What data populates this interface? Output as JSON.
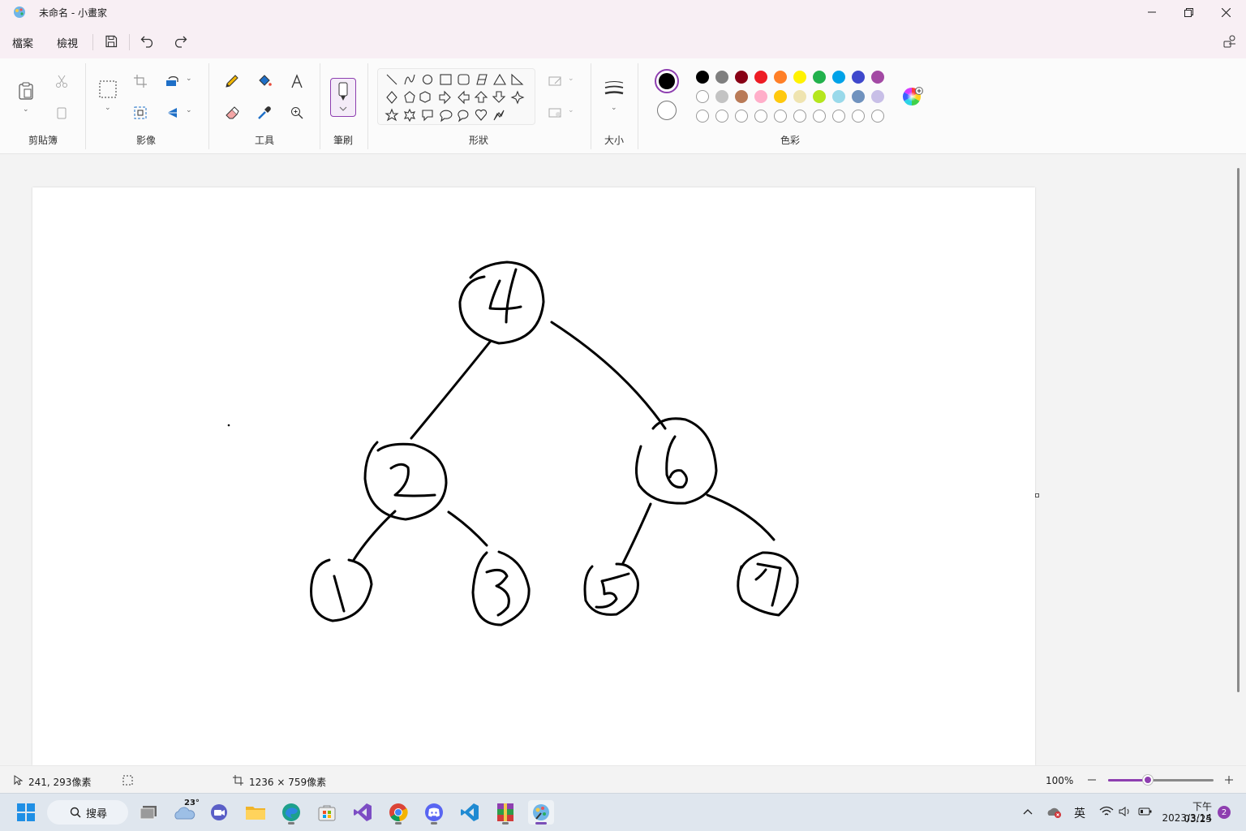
{
  "window": {
    "title": "未命名 - 小畫家"
  },
  "menu": {
    "file": "檔案",
    "view": "檢視"
  },
  "ribbon": {
    "groups": {
      "clipboard": "剪貼簿",
      "image": "影像",
      "tools": "工具",
      "brush": "筆刷",
      "shapes": "形狀",
      "size": "大小",
      "colors": "色彩"
    },
    "colors": {
      "primary": "#000000",
      "secondary": "#ffffff",
      "row1": [
        "#000000",
        "#7f7f7f",
        "#880015",
        "#ed1c24",
        "#ff7f27",
        "#fff200",
        "#22b14c",
        "#00a2e8",
        "#3f48cc",
        "#a349a4"
      ],
      "row2": [
        "#ffffff",
        "#c3c3c3",
        "#b97a57",
        "#ffaec9",
        "#ffc90e",
        "#efe4b0",
        "#b5e61d",
        "#99d9ea",
        "#7092be",
        "#c8bfe7"
      ]
    }
  },
  "drawing": {
    "nodes": [
      "4",
      "2",
      "6",
      "1",
      "3",
      "5",
      "7"
    ]
  },
  "status": {
    "cursor_position": "241, 293像素",
    "canvas_size": "1236 × 759像素",
    "zoom": "100%",
    "zoom_level": 0.38
  },
  "taskbar": {
    "search_label": "搜尋",
    "weather_temp": "23°",
    "ime": "英",
    "time": "下午 03:25",
    "date": "2023/3/14",
    "notifications": "2"
  }
}
